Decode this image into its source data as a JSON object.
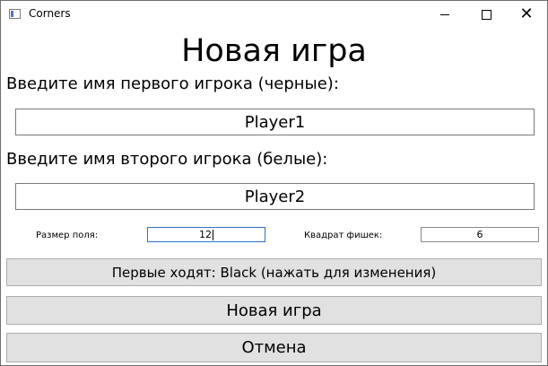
{
  "window": {
    "title": "Corners",
    "icon": "app-window-icon",
    "controls": {
      "minimize_icon": "minimize-icon",
      "maximize_icon": "maximize-icon",
      "close_glyph": "✕"
    }
  },
  "main": {
    "heading": "Новая игра",
    "player1_label": "Введите имя первого игрока (черные):",
    "player1_value": "Player1",
    "player2_label": "Введите имя второго игрока (белые):",
    "player2_value": "Player2",
    "board_size_label": "Размер поля:",
    "board_size_value": "12",
    "chips_square_label": "Квадрат фишек:",
    "chips_square_value": "6",
    "first_move_button": "Первые ходят: Black (нажать для изменения)",
    "new_game_button": "Новая игра",
    "cancel_button": "Отмена"
  },
  "colors": {
    "button_bg": "#e1e1e1",
    "focus_border": "#2f6fc4",
    "input_border": "#7a7a7a"
  }
}
